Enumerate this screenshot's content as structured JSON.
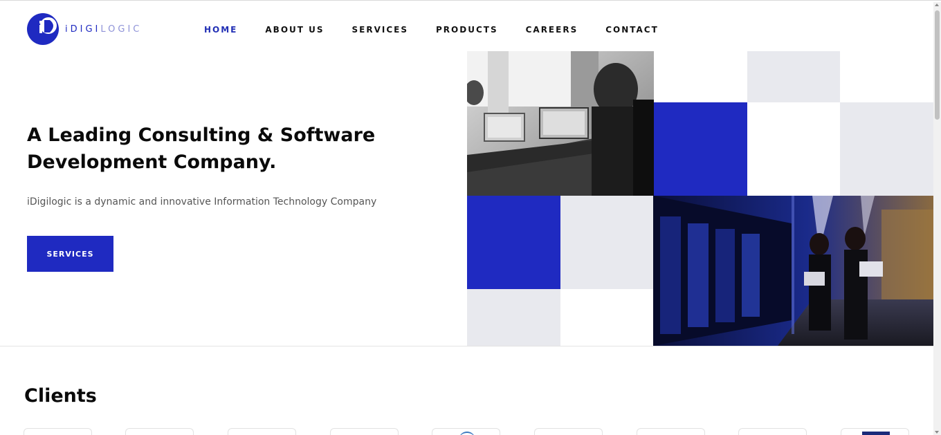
{
  "brand": {
    "logo_prefix": "iDIGI",
    "logo_suffix": "LOGIC",
    "primary_color": "#1f2ac1",
    "light_gray": "#e8e9ee"
  },
  "nav": {
    "items": [
      {
        "label": "HOME",
        "active": true
      },
      {
        "label": "ABOUT US",
        "active": false
      },
      {
        "label": "SERVICES",
        "active": false
      },
      {
        "label": "PRODUCTS",
        "active": false
      },
      {
        "label": "CAREERS",
        "active": false
      },
      {
        "label": "CONTACT",
        "active": false
      }
    ]
  },
  "hero": {
    "title_line1": "A Leading Consulting & Software",
    "title_line2": "Development Company.",
    "subtitle": "iDigilogic is a dynamic and innovative Information Technology Company",
    "cta_label": "SERVICES"
  },
  "clients": {
    "heading": "Clients"
  }
}
